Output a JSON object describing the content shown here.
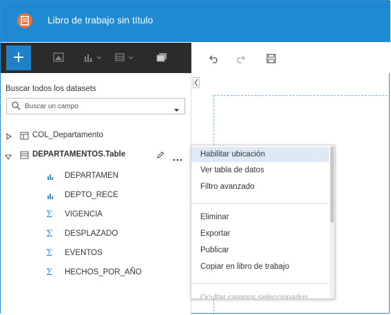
{
  "app": {
    "title": "Libro de trabajo sin título"
  },
  "toolbar": {
    "add_label": "+",
    "icons": [
      "add-icon",
      "map-icon",
      "chart-icon",
      "table-icon",
      "duplicate-icon",
      "undo-icon",
      "redo-icon",
      "save-icon"
    ]
  },
  "sidebar": {
    "search_label": "Buscar todos los datasets",
    "search_placeholder": "Buscar un campo",
    "datasets": [
      {
        "name": "COL_Departamento",
        "expanded": false
      },
      {
        "name": "DEPARTAMENTOS.Table",
        "expanded": true
      }
    ],
    "fields": [
      {
        "name": "DEPARTAMEN",
        "type": "string"
      },
      {
        "name": "DEPTO_RECE",
        "type": "string"
      },
      {
        "name": "VIGENCIA",
        "type": "number"
      },
      {
        "name": "DESPLAZADO",
        "type": "number"
      },
      {
        "name": "EVENTOS",
        "type": "number"
      },
      {
        "name": "HECHOS_POR_AÑO",
        "type": "number"
      }
    ]
  },
  "context_menu": {
    "items": [
      {
        "label": "Habilitar ubicación",
        "active": true
      },
      {
        "label": "Ver tabla de datos"
      },
      {
        "label": "Filtro avanzado"
      },
      {
        "label": "Eliminar"
      },
      {
        "label": "Exportar"
      },
      {
        "label": "Publicar"
      },
      {
        "label": "Copiar en libro de trabajo"
      },
      {
        "label": "Ocultar campos seleccionados"
      }
    ]
  },
  "colors": {
    "accent": "#1f8ad1",
    "toolbar_dark": "#2b2b2b",
    "app_icon": "#e8743b",
    "menu_highlight": "#dfe9f5"
  }
}
